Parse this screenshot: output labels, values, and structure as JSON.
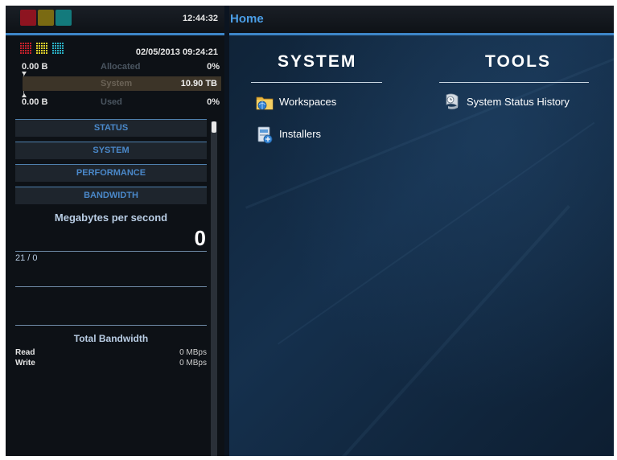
{
  "clock": "12:44:32",
  "page_title": "Home",
  "datetime": "02/05/2013 09:24:21",
  "allocated": {
    "left_value": "0.00 B",
    "label": "Allocated",
    "percent": "0%"
  },
  "system_capacity": {
    "label": "System",
    "value": "10.90 TB"
  },
  "used": {
    "left_value": "0.00 B",
    "label": "Used",
    "percent": "0%"
  },
  "menu": [
    "STATUS",
    "SYSTEM",
    "PERFORMANCE",
    "BANDWIDTH"
  ],
  "bandwidth_panel": {
    "title": "Megabytes per second",
    "ratio": "21 / 0",
    "big_value": "0",
    "total_title": "Total Bandwidth",
    "rows": [
      {
        "label": "Read",
        "value": "0 MBps"
      },
      {
        "label": "Write",
        "value": "0 MBps"
      }
    ]
  },
  "columns": {
    "system": {
      "heading": "SYSTEM",
      "links": [
        {
          "label": "Workspaces",
          "icon": "folder-globe-icon"
        },
        {
          "label": "Installers",
          "icon": "installer-icon"
        }
      ]
    },
    "tools": {
      "heading": "TOOLS",
      "links": [
        {
          "label": "System Status History",
          "icon": "status-history-icon"
        }
      ]
    }
  },
  "colors": {
    "accent": "#3d86c8",
    "home": "#4b9ee6",
    "alert_red": "#c8202a",
    "warn_yellow": "#e0d12a",
    "ok_teal": "#2ab0c4"
  }
}
